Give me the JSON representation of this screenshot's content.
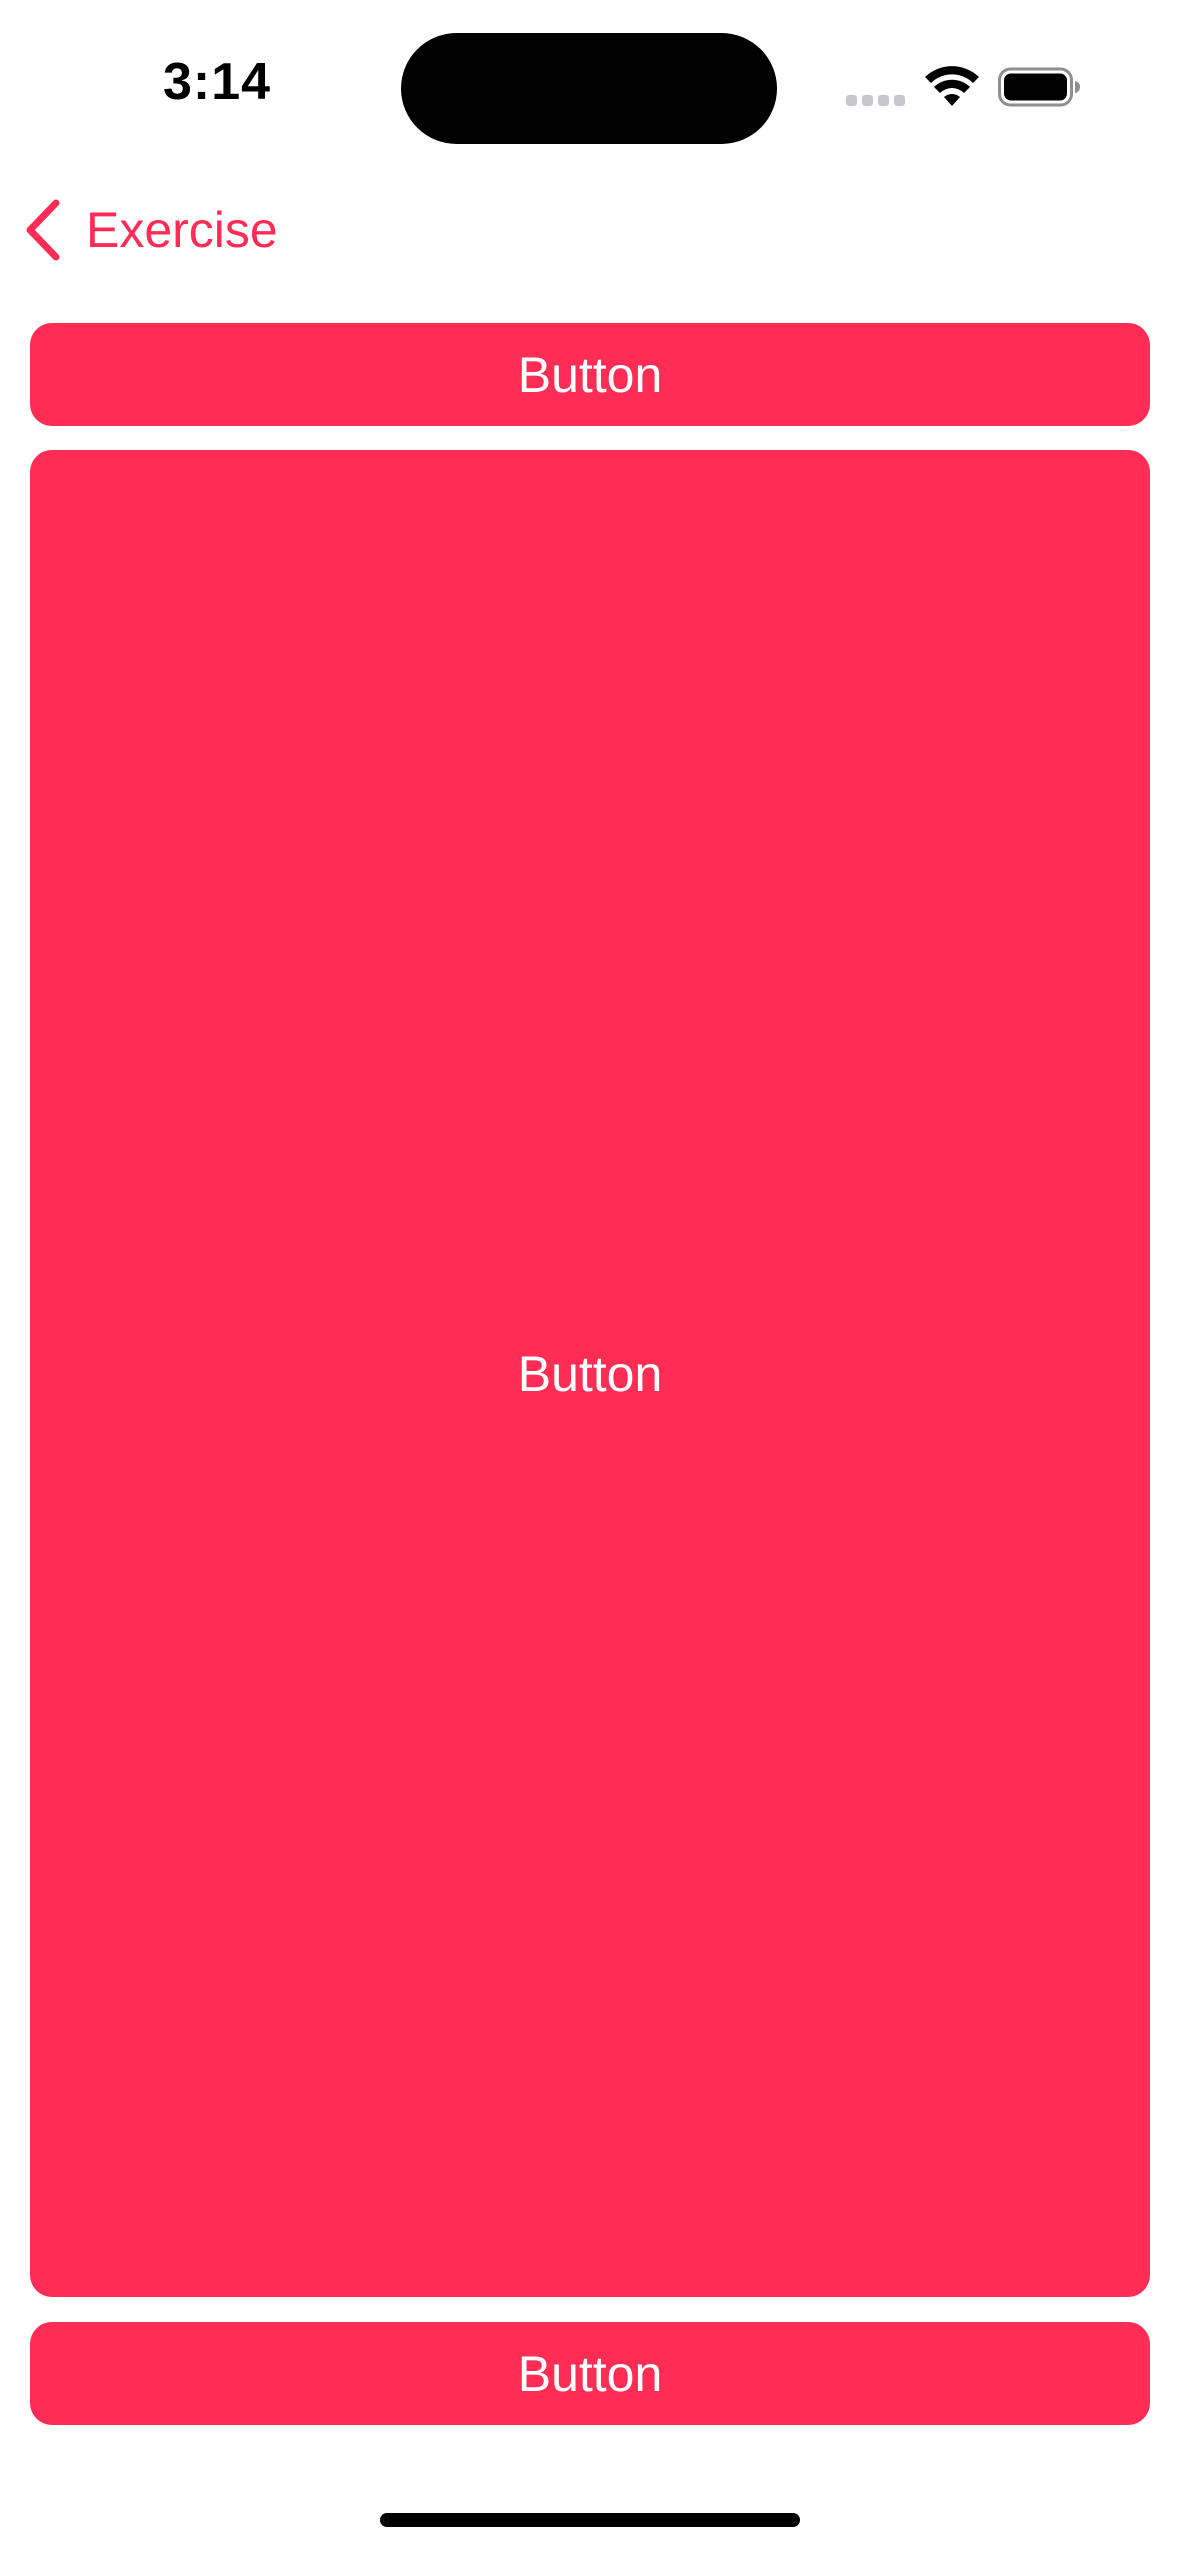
{
  "status_bar": {
    "time": "3:14",
    "icons": [
      "cellular-dots-icon",
      "wifi-icon",
      "battery-icon"
    ]
  },
  "nav": {
    "back_label": "Exercise",
    "back_icon": "chevron-left-icon"
  },
  "buttons": [
    {
      "label": "Button"
    },
    {
      "label": "Button"
    },
    {
      "label": "Button"
    }
  ],
  "colors": {
    "accent": "#ff2d55",
    "background": "#ffffff",
    "button_text": "#ffffff"
  }
}
